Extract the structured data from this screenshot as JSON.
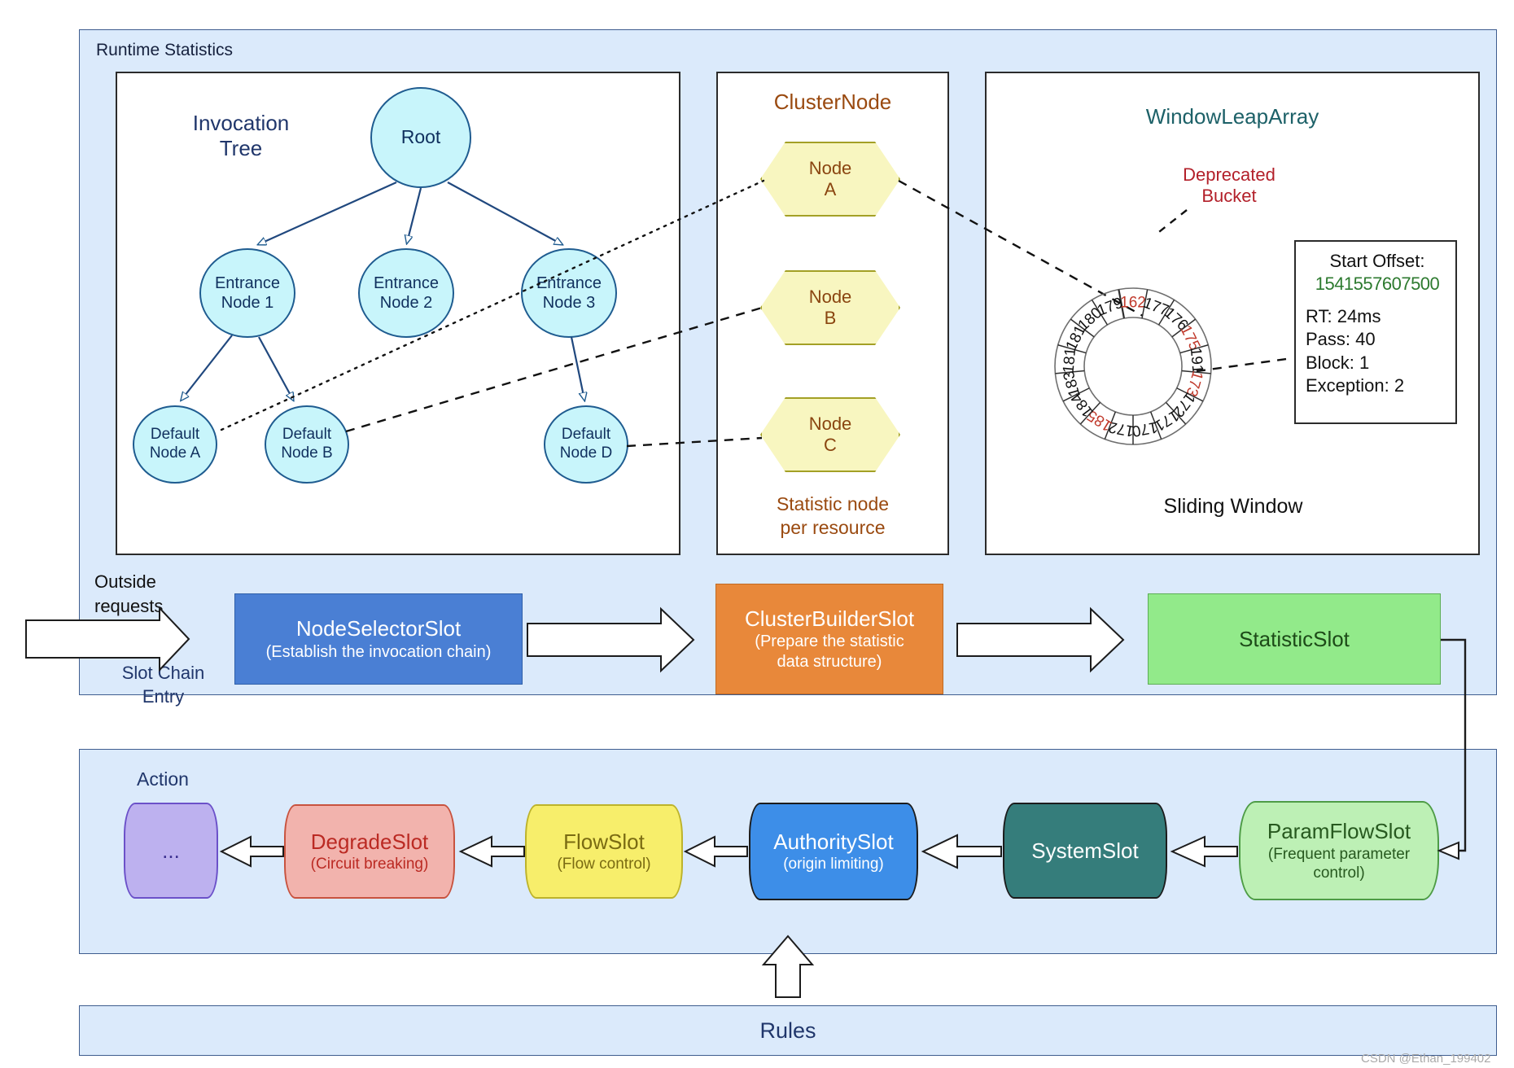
{
  "panels": {
    "runtime_label": "Runtime Statistics",
    "rules_label": "Rules",
    "action_label": "Action"
  },
  "invocation_tree": {
    "title": "Invocation\nTree",
    "nodes": [
      {
        "id": "root",
        "label": "Root"
      },
      {
        "id": "entrance1",
        "label": "Entrance\nNode 1"
      },
      {
        "id": "entrance2",
        "label": "Entrance\nNode 2"
      },
      {
        "id": "entrance3",
        "label": "Entrance\nNode 3"
      },
      {
        "id": "defaultA",
        "label": "Default\nNode A"
      },
      {
        "id": "defaultB",
        "label": "Default\nNode B"
      },
      {
        "id": "defaultD",
        "label": "Default\nNode D"
      }
    ]
  },
  "cluster_node": {
    "title": "ClusterNode",
    "caption": "Statistic node\nper resource",
    "nodes": [
      {
        "id": "nodeA",
        "label": "Node\nA"
      },
      {
        "id": "nodeB",
        "label": "Node\nB"
      },
      {
        "id": "nodeC",
        "label": "Node\nC"
      }
    ]
  },
  "window_leap_array": {
    "title": "WindowLeapArray",
    "deprecated_label": "Deprecated\nBucket",
    "sliding_window_caption": "Sliding Window",
    "info_card": {
      "start_offset_label": "Start Offset:",
      "start_offset_value": "1541557607500",
      "rt": "RT: 24ms",
      "pass": "Pass: 40",
      "block": "Block: 1",
      "exception": "Exception: 2"
    }
  },
  "chart_data": {
    "type": "ring",
    "title": "Sliding Window buckets",
    "note": "Ring of 17 time buckets read clockwise starting at 12 o'clock. Red values are deprecated buckets.",
    "buckets": [
      {
        "value": "162",
        "deprecated": true
      },
      {
        "value": "177",
        "deprecated": false
      },
      {
        "value": "176",
        "deprecated": false
      },
      {
        "value": "175",
        "deprecated": true
      },
      {
        "value": "191",
        "deprecated": false
      },
      {
        "value": "173",
        "deprecated": true
      },
      {
        "value": "172",
        "deprecated": false
      },
      {
        "value": "171",
        "deprecated": false
      },
      {
        "value": "170",
        "deprecated": false
      },
      {
        "value": "172",
        "deprecated": false
      },
      {
        "value": "185",
        "deprecated": true
      },
      {
        "value": "184",
        "deprecated": false
      },
      {
        "value": "183",
        "deprecated": false
      },
      {
        "value": "181",
        "deprecated": false
      },
      {
        "value": "181",
        "deprecated": false
      },
      {
        "value": "180",
        "deprecated": false
      },
      {
        "value": "179",
        "deprecated": false
      }
    ],
    "colors": {
      "normal": "#111111",
      "deprecated": "#c0392b"
    }
  },
  "slot_chain": {
    "outside_requests": "Outside\nrequests",
    "entry_label": "Slot Chain\nEntry",
    "slots": [
      {
        "id": "nodeselector",
        "name": "NodeSelectorSlot",
        "sub": "(Establish the invocation chain)"
      },
      {
        "id": "clusterbuilder",
        "name": "ClusterBuilderSlot",
        "sub": "(Prepare the statistic\ndata structure)"
      },
      {
        "id": "statisticslot",
        "name": "StatisticSlot",
        "sub": ""
      }
    ]
  },
  "action_chain": {
    "slots": [
      {
        "id": "dots",
        "name": "...",
        "sub": ""
      },
      {
        "id": "degrade",
        "name": "DegradeSlot",
        "sub": "(Circuit breaking)"
      },
      {
        "id": "flow",
        "name": "FlowSlot",
        "sub": "(Flow control)"
      },
      {
        "id": "authority",
        "name": "AuthoritySlot",
        "sub": "(origin limiting)"
      },
      {
        "id": "system",
        "name": "SystemSlot",
        "sub": ""
      },
      {
        "id": "paramflow",
        "name": "ParamFlowSlot",
        "sub": "(Frequent parameter\ncontrol)"
      }
    ]
  },
  "watermark": "CSDN @Ethan_199402",
  "colors": {
    "panel_bg": "#dbeafb",
    "tree_node": "#c8f5fb",
    "hexagon": "#f8f6c0",
    "nodeselector": "#4a7fd4",
    "clusterbuilder": "#e8883a",
    "statisticslot": "#92ea8a",
    "degrade": "#f2b3ad",
    "flow": "#f7ee6b",
    "authority": "#3d8ee8",
    "system": "#357d7b",
    "paramflow": "#bdf0b5",
    "dots": "#bdb1ef",
    "deprecated": "#c0392b",
    "start_offset": "#2d7a2f"
  }
}
